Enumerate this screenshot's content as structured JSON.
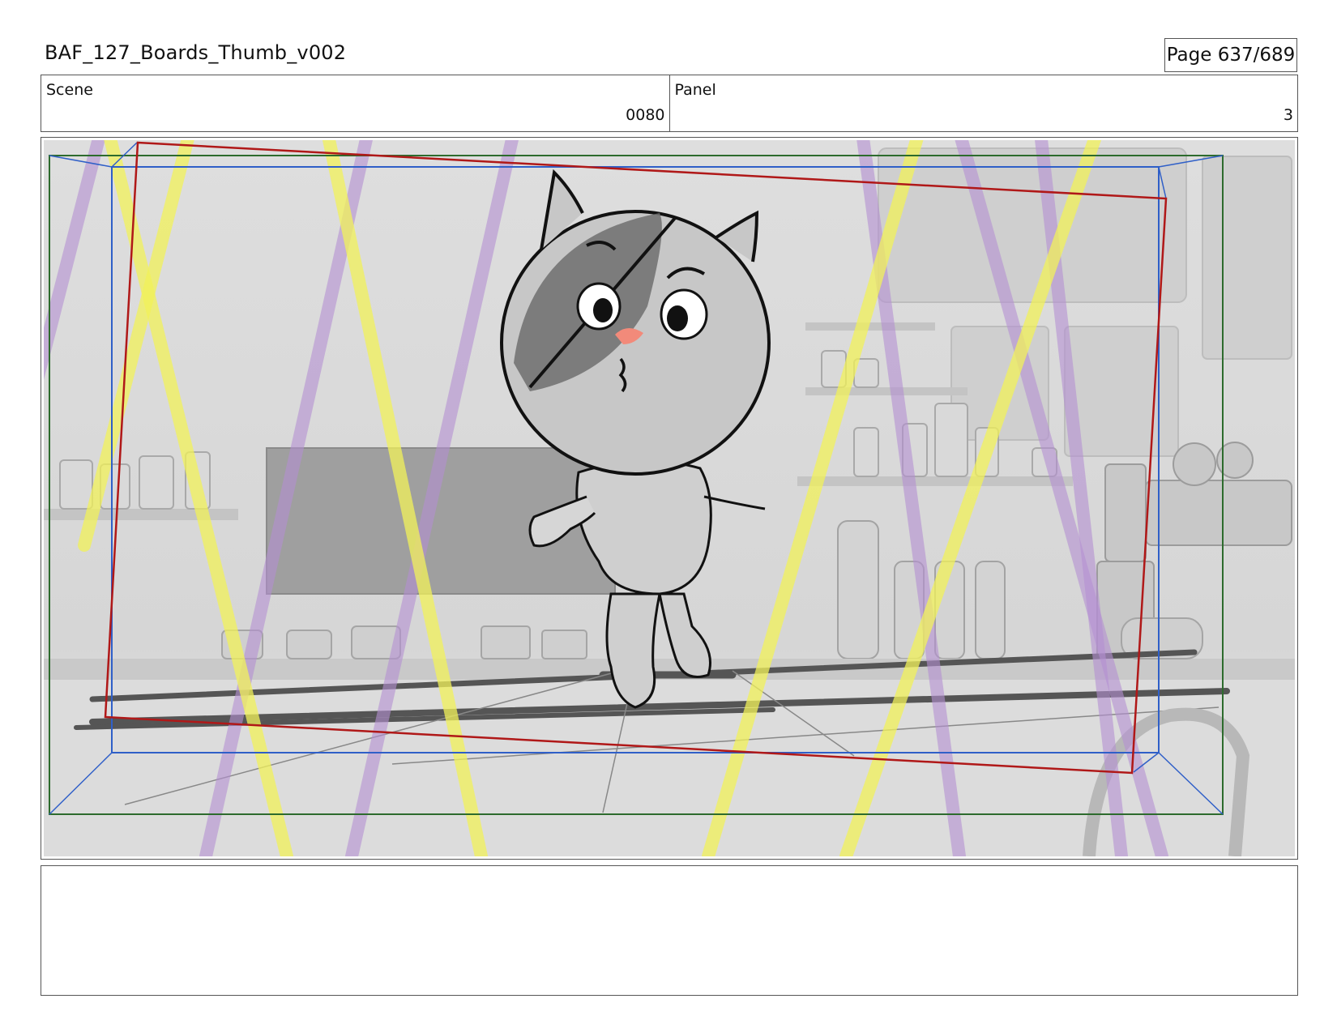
{
  "header": {
    "title": "BAF_127_Boards_Thumb_v002",
    "page": "Page 637/689"
  },
  "scene": {
    "label": "Scene",
    "value": "0080"
  },
  "panel": {
    "label": "Panel",
    "value": "3"
  },
  "colors": {
    "border": "#555555",
    "title_safe": "#2f5fc8",
    "action_safe": "#2d6b2d",
    "camera_frame": "#b01818",
    "yellow_light": "#f2f25a",
    "purple_light": "#b48fd2",
    "cat_pink": "#f28a7a"
  },
  "notes": {
    "text": ""
  }
}
